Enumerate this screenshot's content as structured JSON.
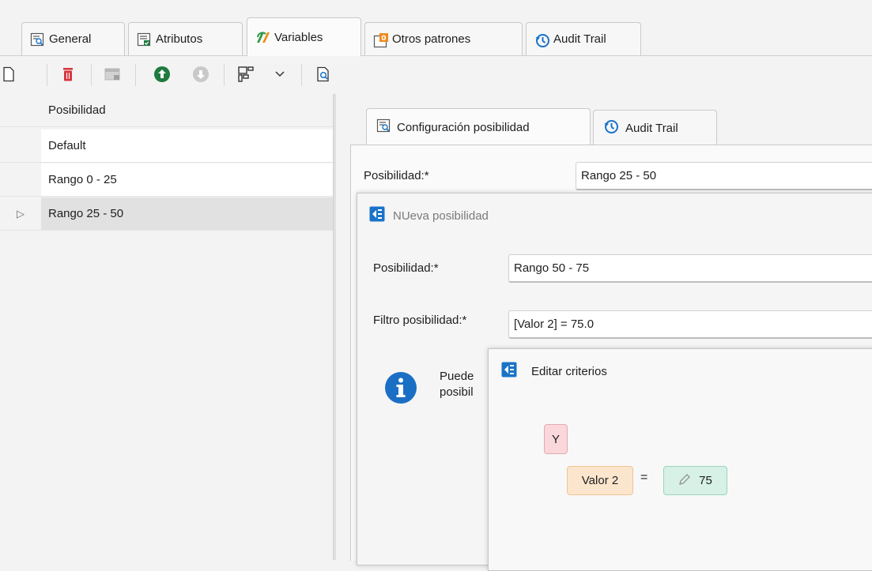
{
  "top_tabs": [
    {
      "label": "General"
    },
    {
      "label": "Atributos"
    },
    {
      "label": "Variables"
    },
    {
      "label": "Otros patrones"
    },
    {
      "label": "Audit Trail"
    }
  ],
  "grid": {
    "header": "Posibilidad",
    "rows": [
      "Default",
      "Rango 0 - 25",
      "Rango 25 - 50"
    ],
    "selected_indicator": "▷"
  },
  "detail": {
    "tabs": [
      {
        "label": "Configuración posibilidad"
      },
      {
        "label": "Audit Trail"
      }
    ],
    "posibilidad_label": "Posibilidad:*",
    "posibilidad_value": "Rango 25 - 50"
  },
  "new_dialog": {
    "title": "NUeva posibilidad",
    "posibilidad_label": "Posibilidad:*",
    "posibilidad_value": "Rango 50 - 75",
    "filtro_label": "Filtro posibilidad:*",
    "filtro_value": "[Valor 2] = 75.0",
    "info_text_line1": "Puede",
    "info_text_line2": "posibil"
  },
  "criteria_dialog": {
    "title": "Editar criterios",
    "group_operator": "Y",
    "field": "Valor 2",
    "operator": "=",
    "value": "75"
  },
  "colors": {
    "accent_blue": "#1a73c9",
    "delete_red": "#d9343c",
    "green": "#1e7a3e",
    "chip_and_bg": "#f9d7da",
    "chip_field_bg": "#fbe5cc",
    "chip_value_bg": "#d7f1e6"
  }
}
